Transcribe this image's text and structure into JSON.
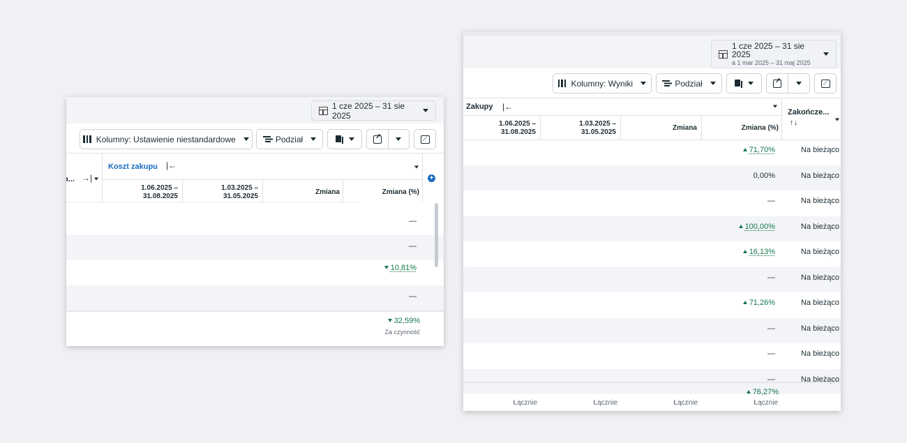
{
  "left_panel": {
    "date_range": "1 cze 2025 – 31 sie 2025",
    "toolbar": {
      "columns_label": "Kolumny: Ustawienie niestandardowe",
      "breakdown_label": "Podział"
    },
    "truncated_prev_header": "p...",
    "column_group": "Koszt zakupu",
    "headers": {
      "period1": "1.06.2025 –",
      "period1b": "31.08.2025",
      "period2": "1.03.2025 –",
      "period2b": "31.05.2025",
      "change": "Zmiana",
      "change_pct": "Zmiana (%)"
    },
    "rows": [
      {
        "change_pct": "—"
      },
      {
        "change_pct": "—"
      },
      {
        "change_pct": "10,81%",
        "direction": "down"
      },
      {
        "change_pct": "—"
      }
    ],
    "total": {
      "change_pct": "32,59%",
      "direction": "down",
      "label": "Za czynność"
    }
  },
  "right_panel": {
    "date_range": "1 cze 2025 – 31 sie 2025",
    "compare_range": "a 1 mar 2025 – 31 maj 2025",
    "toolbar": {
      "columns_label": "Kolumny: Wyniki",
      "breakdown_label": "Podział"
    },
    "column_group": "Zakupy",
    "ending_header": "Zakończe...",
    "sort_glyph": "↑↓",
    "headers": {
      "period1": "1.06.2025 –",
      "period1b": "31.08.2025",
      "period2": "1.03.2025 –",
      "period2b": "31.05.2025",
      "change": "Zmiana",
      "change_pct": "Zmiana (%)"
    },
    "rows": [
      {
        "change_pct": "71,70%",
        "direction": "up",
        "underlined": true,
        "ending": "Na bieżąco"
      },
      {
        "change_pct": "0,00%",
        "direction": "none",
        "ending": "Na bieżąco"
      },
      {
        "change_pct": "—",
        "direction": "none",
        "ending": "Na bieżąco"
      },
      {
        "change_pct": "100,00%",
        "direction": "up",
        "underlined": true,
        "ending": "Na bieżąco"
      },
      {
        "change_pct": "16,13%",
        "direction": "up",
        "underlined": true,
        "ending": "Na bieżąco"
      },
      {
        "change_pct": "—",
        "direction": "none",
        "ending": "Na bieżąco"
      },
      {
        "change_pct": "71,26%",
        "direction": "up",
        "ending": "Na bieżąco"
      },
      {
        "change_pct": "—",
        "direction": "none",
        "ending": "Na bieżąco"
      },
      {
        "change_pct": "—",
        "direction": "none",
        "ending": "Na bieżąco"
      },
      {
        "change_pct": "—",
        "direction": "none",
        "ending": "Na bieżąco"
      }
    ],
    "total": {
      "change_pct": "76,27%",
      "direction": "up",
      "labels": [
        "Łącznie",
        "Łącznie",
        "Łącznie",
        "Łącznie"
      ]
    }
  },
  "colors": {
    "positive": "#14774c",
    "link_blue": "#1a6bbf",
    "background": "#f0f1f4"
  }
}
